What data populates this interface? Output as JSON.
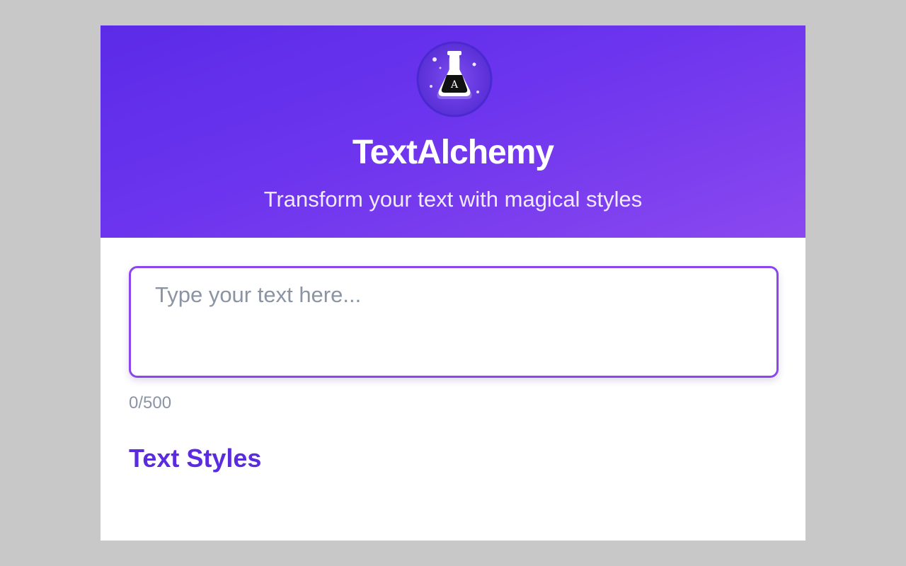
{
  "header": {
    "title": "TextAlchemy",
    "subtitle": "Transform your text with magical styles",
    "logo_icon": "potion-flask-icon",
    "logo_letter": "A",
    "gradient_start": "#5b2be8",
    "gradient_end": "#8a48ef"
  },
  "input": {
    "placeholder": "Type your text here...",
    "value": "",
    "char_count": "0/500",
    "border_color": "#8b47ec"
  },
  "styles_section": {
    "title": "Text Styles",
    "title_color": "#5b2be0"
  }
}
